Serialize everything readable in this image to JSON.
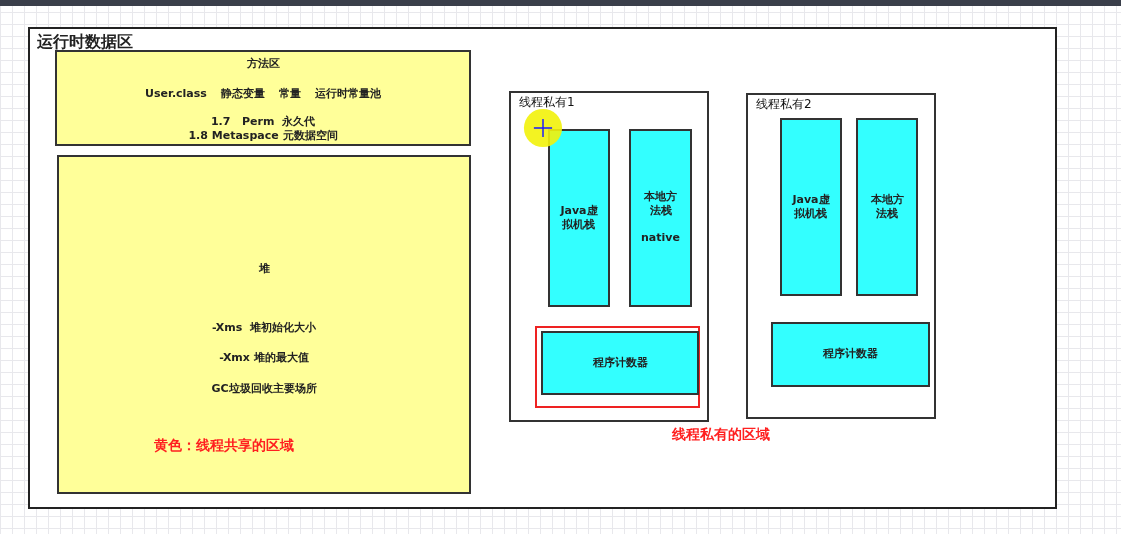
{
  "title": "运行时数据区",
  "method_area": {
    "title": "方法区",
    "items": [
      "User.class",
      "静态变量",
      "常量",
      "运行时常量池"
    ],
    "versions": [
      "1.7   Perm  永久代",
      "1.8 Metaspace 元数据空间"
    ]
  },
  "heap": {
    "title": "堆",
    "lines": [
      "-Xms  堆初始化大小",
      "-Xmx 堆的最大值",
      "GC垃圾回收主要场所"
    ],
    "note": "黄色：线程共享的区域"
  },
  "threads": [
    {
      "label": "线程私有1",
      "stacks": [
        {
          "lines": [
            "Java虚",
            "拟机栈"
          ]
        },
        {
          "lines": [
            "本地方",
            "法栈"
          ],
          "note": "native"
        }
      ],
      "counter": {
        "label": "程序计数器",
        "highlighted": true
      }
    },
    {
      "label": "线程私有2",
      "stacks": [
        {
          "lines": [
            "Java虚",
            "拟机栈"
          ]
        },
        {
          "lines": [
            "本地方",
            "法栈"
          ]
        }
      ],
      "counter": {
        "label": "程序计数器",
        "highlighted": false
      }
    }
  ],
  "private_note": "线程私有的区域"
}
